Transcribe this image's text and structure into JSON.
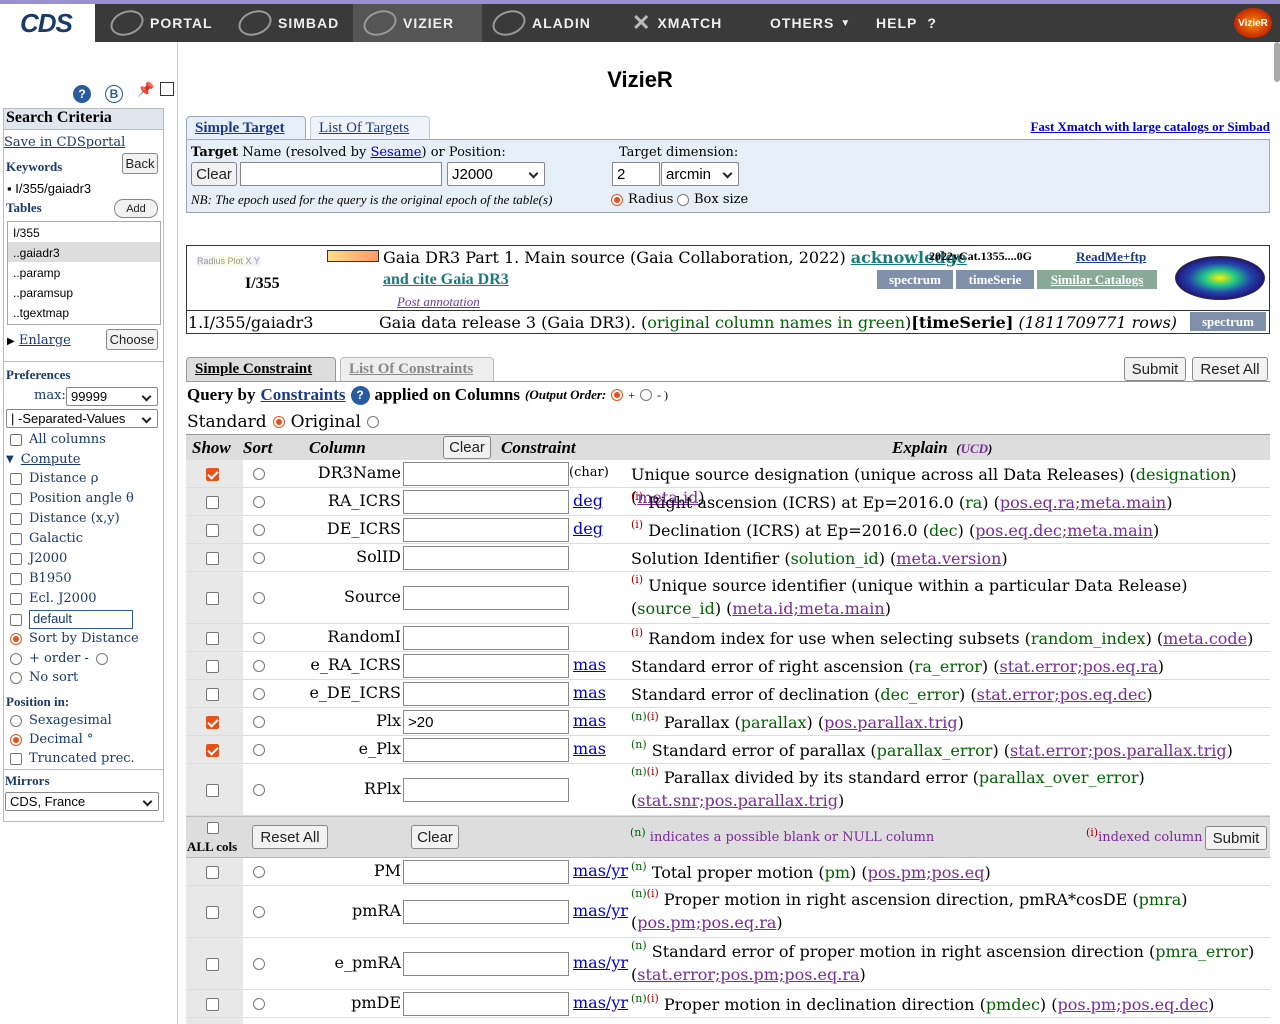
{
  "nav": {
    "logo": "CDS",
    "items": [
      {
        "label": "PORTAL"
      },
      {
        "label": "SIMBAD"
      },
      {
        "label": "VIZIER"
      },
      {
        "label": "ALADIN"
      },
      {
        "label": "XMATCH"
      },
      {
        "label": "OTHERS"
      },
      {
        "label": "HELP"
      }
    ],
    "help_symbol": "?",
    "vizier_logo": "VizieR"
  },
  "page_title": "VizieR",
  "sidebar": {
    "search_criteria": "Search Criteria",
    "save_link": "Save in CDSportal",
    "keywords_label": "Keywords",
    "back_button": "Back",
    "keyword_value": "I/355/gaiadr3",
    "tables_label": "Tables",
    "add_button": "Add",
    "tables": [
      "I/355",
      "..gaiadr3",
      "..paramp",
      "..paramsup",
      "..tgextmap"
    ],
    "enlarge": "Enlarge",
    "choose_button": "Choose",
    "preferences_label": "Preferences",
    "max_label": "max:",
    "max_value": "99999",
    "format_value": "| -Separated-Values",
    "all_columns": "All columns",
    "compute_label": "Compute",
    "compute_items": [
      "Distance ρ",
      "Position angle θ",
      "Distance (x,y)",
      "Galactic",
      "J2000",
      "B1950",
      "Ecl. J2000"
    ],
    "default_input": "default",
    "sort_by_distance": "Sort by Distance",
    "order_label": "+ order -",
    "no_sort": "No sort",
    "position_in": "Position in:",
    "position_options": [
      "Sexagesimal",
      "Decimal °",
      "Truncated prec."
    ],
    "mirrors_label": "Mirrors",
    "mirror_value": "CDS, France",
    "icons": {
      "help": "?",
      "b": "B"
    }
  },
  "target": {
    "tab_simple": "Simple Target",
    "tab_list": "List Of Targets",
    "fast_xmatch": "Fast Xmatch with large catalogs or Simbad",
    "target_label": "Target",
    "name_text": "Name (resolved by",
    "sesame": "Sesame",
    "or_position": ") or Position:",
    "clear_button": "Clear",
    "epoch_value": "J2000",
    "dimension_label": "Target dimension:",
    "dimension_value": "2",
    "unit_value": "arcmin",
    "note": "NB: The epoch used for the query is the original epoch of the table(s)",
    "radius": "Radius",
    "box_size": "Box size"
  },
  "catalog": {
    "id": "I/355",
    "mini_labels": "Radius  Plot  X  Y",
    "title": "Gaia DR3 Part 1. Main source (Gaia Collaboration, 2022)",
    "acknowledge": "acknowledge",
    "cite": "and cite Gaia DR3",
    "bibcode": "2022yCat.1355....0G",
    "readme": "ReadMe+ftp",
    "spectrum": "spectrum",
    "timeserie": "timeSerie",
    "similar": "Similar Catalogs",
    "post_annotation": "Post annotation",
    "table_name": "1.I/355/gaiadr3",
    "table_desc": "Gaia data release 3 (Gaia DR3). (",
    "original_names": "original column names in green",
    "desc_close": ")",
    "timeserie_tag": "[timeSerie]",
    "rows": "(1811709771 rows)",
    "spectrum2": "spectrum"
  },
  "constraints": {
    "tab_simple": "Simple Constraint",
    "tab_list": "List Of Constraints",
    "submit": "Submit",
    "reset_all": "Reset All",
    "query_by": "Query by",
    "constraints_link": "Constraints",
    "applied": "applied on Columns",
    "output_order": "(Output Order:",
    "plus": "+",
    "minus": "- )",
    "standard": "Standard",
    "original": "Original",
    "header": {
      "show": "Show",
      "sort": "Sort",
      "column": "Column",
      "clear": "Clear",
      "constraint": "Constraint",
      "explain": "Explain",
      "ucd_open": "(",
      "ucd": "UCD",
      "ucd_close": ")"
    }
  },
  "rows": [
    {
      "show": true,
      "name": "DR3Name",
      "value": "",
      "unit": "(char)",
      "unit_link": false,
      "flags": "",
      "desc": "Unique source designation (unique across all Data Releases) (",
      "orig": "designation",
      "mid": ") (",
      "ucd": "meta.id",
      "end": ")"
    },
    {
      "show": false,
      "name": "RA_ICRS",
      "value": "",
      "unit": "deg",
      "unit_link": true,
      "flags": "(i)",
      "desc": " Right ascension (ICRS) at Ep=2016.0 (",
      "orig": "ra",
      "mid": ") (",
      "ucd": "pos.eq.ra;meta.main",
      "end": ")"
    },
    {
      "show": false,
      "name": "DE_ICRS",
      "value": "",
      "unit": "deg",
      "unit_link": true,
      "flags": "(i)",
      "desc": " Declination (ICRS) at Ep=2016.0 (",
      "orig": "dec",
      "mid": ") (",
      "ucd": "pos.eq.dec;meta.main",
      "end": ")"
    },
    {
      "show": false,
      "name": "SolID",
      "value": "",
      "unit": "",
      "unit_link": false,
      "flags": "",
      "desc": "Solution Identifier (",
      "orig": "solution_id",
      "mid": ") (",
      "ucd": "meta.version",
      "end": ")"
    },
    {
      "show": false,
      "name": "Source",
      "value": "",
      "unit": "",
      "unit_link": false,
      "flags": "(i)",
      "desc": " Unique source identifier (unique within a particular Data Release) (",
      "orig": "source_id",
      "mid": ") (",
      "ucd": "meta.id;meta.main",
      "end": ")"
    },
    {
      "show": false,
      "name": "RandomI",
      "value": "",
      "unit": "",
      "unit_link": false,
      "flags": "(i)",
      "desc": " Random index for use when selecting subsets (",
      "orig": "random_index",
      "mid": ") (",
      "ucd": "meta.code",
      "end": ")"
    },
    {
      "show": false,
      "name": "e_RA_ICRS",
      "value": "",
      "unit": "mas",
      "unit_link": true,
      "flags": "",
      "desc": "Standard error of right ascension (",
      "orig": "ra_error",
      "mid": ") (",
      "ucd": "stat.error;pos.eq.ra",
      "end": ")"
    },
    {
      "show": false,
      "name": "e_DE_ICRS",
      "value": "",
      "unit": "mas",
      "unit_link": true,
      "flags": "",
      "desc": "Standard error of declination (",
      "orig": "dec_error",
      "mid": ") (",
      "ucd": "stat.error;pos.eq.dec",
      "end": ")"
    },
    {
      "show": true,
      "name": "Plx",
      "value": ">20",
      "unit": "mas",
      "unit_link": true,
      "flags": "(n)(i)",
      "desc": " Parallax (",
      "orig": "parallax",
      "mid": ") (",
      "ucd": "pos.parallax.trig",
      "end": ")"
    },
    {
      "show": true,
      "name": "e_Plx",
      "value": "",
      "unit": "mas",
      "unit_link": true,
      "flags": "(n)",
      "desc": " Standard error of parallax (",
      "orig": "parallax_error",
      "mid": ") (",
      "ucd": "stat.error;pos.parallax.trig",
      "end": ")"
    },
    {
      "show": false,
      "name": "RPlx",
      "value": "",
      "unit": "",
      "unit_link": false,
      "flags": "(n)(i)",
      "desc": " Parallax divided by its standard error (",
      "orig": "parallax_over_error",
      "mid": ") (",
      "ucd": "stat.snr;pos.parallax.trig",
      "end": ")"
    }
  ],
  "midbar": {
    "all_cols": "ALL cols",
    "reset_all": "Reset All",
    "clear": "Clear",
    "n_flag": "(n)",
    "n_text": " indicates a possible blank or NULL column",
    "i_flag": "(i)",
    "i_text": "indexed column",
    "submit": "Submit"
  },
  "rows2": [
    {
      "show": false,
      "name": "PM",
      "value": "",
      "unit": "mas/yr",
      "unit_link": true,
      "flags": "(n)",
      "desc": " Total proper motion (",
      "orig": "pm",
      "mid": ") (",
      "ucd": "pos.pm;pos.eq",
      "end": ")"
    },
    {
      "show": false,
      "name": "pmRA",
      "value": "",
      "unit": "mas/yr",
      "unit_link": true,
      "flags": "(n)(i)",
      "desc": " Proper motion in right ascension direction, pmRA*cosDE (",
      "orig": "pmra",
      "mid": ") (",
      "ucd": "pos.pm;pos.eq.ra",
      "end": ")"
    },
    {
      "show": false,
      "name": "e_pmRA",
      "value": "",
      "unit": "mas/yr",
      "unit_link": true,
      "flags": "(n)",
      "desc": " Standard error of proper motion in right ascension direction (",
      "orig": "pmra_error",
      "mid": ") (",
      "ucd": "stat.error;pos.pm;pos.eq.ra",
      "end": ")"
    },
    {
      "show": false,
      "name": "pmDE",
      "value": "",
      "unit": "mas/yr",
      "unit_link": true,
      "flags": "(n)(i)",
      "desc": " Proper motion in declination direction (",
      "orig": "pmdec",
      "mid": ") (",
      "ucd": "pos.pm;pos.eq.dec",
      "end": ")"
    }
  ]
}
